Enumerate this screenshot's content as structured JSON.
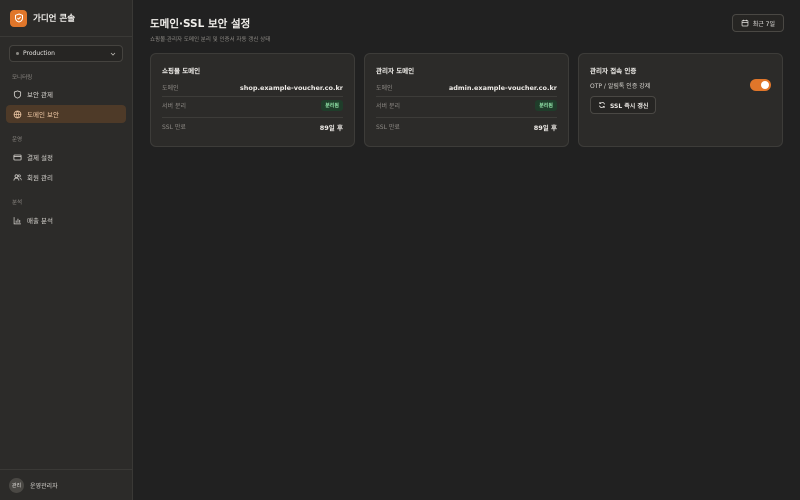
{
  "app": {
    "brand": "가디언 콘솔",
    "environment": "Production"
  },
  "sidebar": {
    "sections": [
      {
        "label": "모니터링",
        "items": [
          {
            "label": "보안 관제",
            "icon": "shield-icon"
          },
          {
            "label": "도메인 보안",
            "icon": "globe-shield-icon",
            "active": true
          }
        ]
      },
      {
        "label": "운영",
        "items": [
          {
            "label": "결제 설정",
            "icon": "credit-card-icon"
          },
          {
            "label": "회원 관리",
            "icon": "users-icon"
          }
        ]
      },
      {
        "label": "분석",
        "items": [
          {
            "label": "매출 분석",
            "icon": "bar-chart-icon"
          }
        ]
      }
    ]
  },
  "user": {
    "avatar": "관리",
    "name": "운영관리자"
  },
  "header": {
    "title": "도메인·SSL 보안 설정",
    "subtitle": "쇼핑몰·관리자 도메인 분리 및 인증서 자동 갱신 상태",
    "range_label": "최근 7일"
  },
  "cards": {
    "shop": {
      "title": "쇼핑몰 도메인",
      "domain_key": "도메인",
      "domain_value": "shop.example-voucher.co.kr",
      "separation_key": "서버 분리",
      "separation_badge": "분리됨",
      "ssl_key": "SSL 만료",
      "ssl_value": "89일 후"
    },
    "admin": {
      "title": "관리자 도메인",
      "domain_key": "도메인",
      "domain_value": "admin.example-voucher.co.kr",
      "separation_key": "서버 분리",
      "separation_badge": "분리됨",
      "ssl_key": "SSL 만료",
      "ssl_value": "89일 후"
    },
    "auth": {
      "title": "관리자 접속 인증",
      "otp_label": "OTP / 알림톡 인증 강제",
      "otp_enabled": true,
      "renew_label": "SSL 즉시 갱신"
    }
  },
  "colors": {
    "accent": "#e0762a",
    "success": "#8fe0a6"
  }
}
